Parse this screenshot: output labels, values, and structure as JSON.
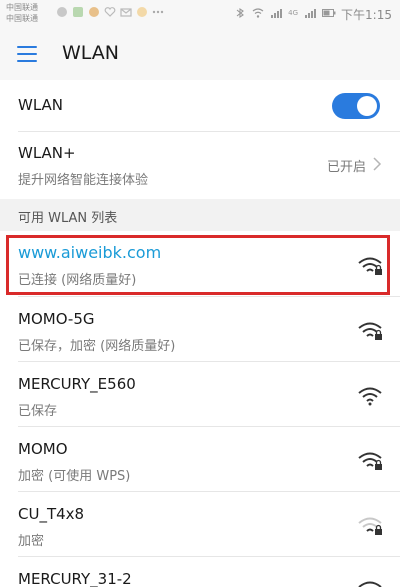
{
  "status_bar": {
    "carrier_lines": [
      "中国联通",
      "中国联通"
    ],
    "network_type": "4G",
    "time": "下午1:15",
    "colors": {
      "text": "#8a8a8a"
    }
  },
  "app_bar": {
    "title": "WLAN"
  },
  "wlan_toggle": {
    "label": "WLAN",
    "state": "on"
  },
  "wlan_plus": {
    "title": "WLAN+",
    "subtitle": "提升网络智能连接体验",
    "value": "已开启"
  },
  "section_header": "可用 WLAN 列表",
  "networks": [
    {
      "ssid": "www.aiweibk.com",
      "status": "已连接 (网络质量好)",
      "locked": true,
      "connected": true
    },
    {
      "ssid": "MOMO-5G",
      "status": "已保存，加密 (网络质量好)",
      "locked": true,
      "connected": false
    },
    {
      "ssid": "MERCURY_E560",
      "status": "已保存",
      "locked": false,
      "connected": false
    },
    {
      "ssid": "MOMO",
      "status": "加密 (可使用 WPS)",
      "locked": true,
      "connected": false
    },
    {
      "ssid": "CU_T4x8",
      "status": "加密",
      "locked": true,
      "connected": false
    },
    {
      "ssid": "MERCURY_31-2",
      "status": "",
      "locked": false,
      "connected": false
    }
  ],
  "colors": {
    "accent": "#2a7bde",
    "highlight": "#d92a2a",
    "connected_text": "#1a9bd7"
  }
}
